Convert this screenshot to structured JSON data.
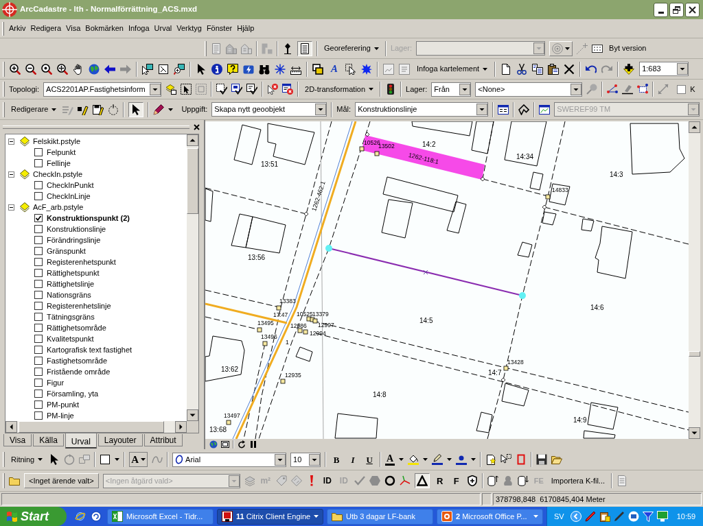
{
  "window": {
    "title": "ArcCadastre - lth - Normalförrättning_ACS.mxd"
  },
  "menu": [
    "Arkiv",
    "Redigera",
    "Visa",
    "Bokmärken",
    "Infoga",
    "Urval",
    "Verktyg",
    "Fönster",
    "Hjälp"
  ],
  "georef_toolbar": {
    "page_tool_pressed": true,
    "menu": "Georeferering",
    "layer": {
      "label": "Lager:",
      "disabled": true
    },
    "version_button": "Byt version"
  },
  "tools_toolbar": {
    "text_tool": "A",
    "insert_menu": "Infoga kartelement",
    "scale": "1:683"
  },
  "topology_toolbar": {
    "label": "Topologi:",
    "topology": "ACS2201AP.Fastighetsinform",
    "transform_menu": "2D-transformation",
    "layer_label": "Lager:",
    "source": "Från",
    "layer": "<None>",
    "option": {
      "label": "K",
      "checked": false
    }
  },
  "editor_toolbar": {
    "menu": "Redigerare",
    "edit_tool_pressed": true,
    "task_label": "Uppgift:",
    "task": "Skapa nytt geoobjekt",
    "target_label": "Mål:",
    "target": "Konstruktionslinje",
    "coordinate_system": {
      "value": "SWEREF99 TM",
      "disabled": true
    }
  },
  "toc": {
    "tree": [
      {
        "label": "Felskikt.pstyle",
        "expanded": true,
        "children": [
          {
            "label": "Felpunkt",
            "checked": false,
            "has_selection": false
          },
          {
            "label": "Fellinje",
            "checked": false,
            "has_selection": false
          }
        ]
      },
      {
        "label": "CheckIn.pstyle",
        "expanded": true,
        "children": [
          {
            "label": "CheckInPunkt",
            "checked": false,
            "has_selection": false
          },
          {
            "label": "CheckInLinje",
            "checked": false,
            "has_selection": false
          }
        ]
      },
      {
        "label": "AcF_arb.pstyle",
        "expanded": true,
        "children": [
          {
            "label": "Konstruktionspunkt (2)",
            "checked": true,
            "has_selection": true
          },
          {
            "label": "Konstruktionslinje",
            "checked": false,
            "has_selection": false
          },
          {
            "label": "Förändringslinje",
            "checked": false,
            "has_selection": false
          },
          {
            "label": "Gränspunkt",
            "checked": false,
            "has_selection": false
          },
          {
            "label": "Registerenhetspunkt",
            "checked": false,
            "has_selection": false
          },
          {
            "label": "Rättighetspunkt",
            "checked": false,
            "has_selection": false
          },
          {
            "label": "Rättighetslinje",
            "checked": false,
            "has_selection": false
          },
          {
            "label": "Nationsgräns",
            "checked": false,
            "has_selection": false
          },
          {
            "label": "Registerenhetslinje",
            "checked": false,
            "has_selection": false
          },
          {
            "label": "Tätningsgräns",
            "checked": false,
            "has_selection": false
          },
          {
            "label": "Rättighetsområde",
            "checked": false,
            "has_selection": false
          },
          {
            "label": "Kvalitetspunkt",
            "checked": false,
            "has_selection": false
          },
          {
            "label": "Kartografisk text fastighet",
            "checked": false,
            "has_selection": false
          },
          {
            "label": "Fastighetsområde",
            "checked": false,
            "has_selection": false
          },
          {
            "label": "Fristående område",
            "checked": false,
            "has_selection": false
          },
          {
            "label": "Figur",
            "checked": false,
            "has_selection": false
          },
          {
            "label": "Församling, yta",
            "checked": false,
            "has_selection": false
          },
          {
            "label": "PM-punkt",
            "checked": false,
            "has_selection": false
          },
          {
            "label": "PM-linje",
            "checked": false,
            "has_selection": false
          }
        ]
      }
    ],
    "tabs": [
      {
        "label": "Visa",
        "selected": false
      },
      {
        "label": "Källa",
        "selected": false
      },
      {
        "label": "Urval",
        "selected": true
      },
      {
        "label": "Layouter",
        "selected": false
      },
      {
        "label": "Attribut",
        "selected": false
      }
    ]
  },
  "map": {
    "parcel_labels": [
      "14:2",
      "14:34",
      "13:51",
      "14:3",
      "13:56",
      "14:6",
      "14:5",
      "13:62",
      "14:7",
      "14:8",
      "14:9",
      "13:68"
    ],
    "line_labels": [
      "1262-118:1",
      "1262-462:1"
    ],
    "point_labels": [
      "10526",
      "13502",
      "14833",
      "13383",
      "17:47",
      "10525",
      "13379",
      "13495",
      "12986",
      "12997",
      "12994",
      "13496",
      "1",
      "12935",
      "13428",
      "13497"
    ]
  },
  "drawing_toolbar": {
    "menu": "Ritning",
    "text_tool": "A",
    "font": "Arial",
    "font_size": "10",
    "bold": "B",
    "italic": "I",
    "underline": "U",
    "font_color": "A"
  },
  "case_toolbar": {
    "case_button": "<Inget ärende valt>",
    "action": {
      "value": "<Ingen åtgärd vald>",
      "disabled": true
    },
    "area_tool": {
      "label": "m²",
      "disabled": true
    },
    "id_tools": [
      {
        "label": "ID",
        "disabled": false
      },
      {
        "label": "ID",
        "disabled": true
      }
    ],
    "triangle_tool_pressed": true,
    "letter_tools": [
      {
        "label": "R",
        "disabled": false
      },
      {
        "label": "F",
        "disabled": false
      }
    ],
    "fe_tool": {
      "label": "FE",
      "disabled": true
    },
    "import_button": "Importera K-fil..."
  },
  "status_bar": {
    "coordinates": "378798,848  6170845,404 Meter"
  },
  "taskbar": {
    "start": "Start",
    "tasks": [
      {
        "label": "Microsoft Excel - Tidr...",
        "selected": false,
        "grouped": false
      },
      {
        "label": "**11** Citrix Client Engine",
        "selected": true,
        "grouped": true
      },
      {
        "label": "Utb 3 dagar LF-bank",
        "selected": false,
        "grouped": false
      },
      {
        "label": "**2** Microsoft Office P...",
        "selected": false,
        "grouped": true
      }
    ],
    "language": "SV",
    "clock": "10:59"
  }
}
